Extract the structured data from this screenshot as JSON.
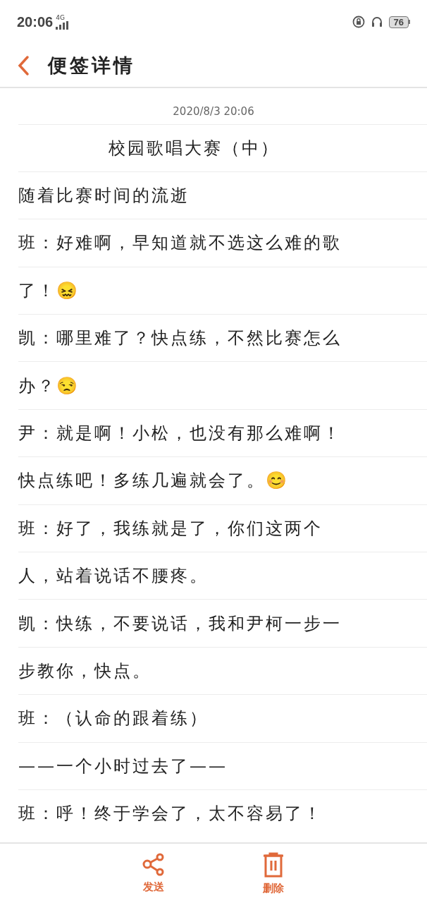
{
  "status_bar": {
    "time": "20:06",
    "network": "4G",
    "battery": "76"
  },
  "header": {
    "title": "便签详情"
  },
  "note": {
    "date": "2020/8/3 20:06",
    "title": "校园歌唱大赛（中）",
    "lines": [
      {
        "text": "随着比赛时间的流逝"
      },
      {
        "text": "班：好难啊，早知道就不选这么难的歌"
      },
      {
        "text": "了！😖"
      },
      {
        "text": "凯：哪里难了？快点练，不然比赛怎么"
      },
      {
        "text": "办？😒"
      },
      {
        "text": "尹：就是啊！小松，也没有那么难啊！"
      },
      {
        "text": "快点练吧！多练几遍就会了。😊"
      },
      {
        "text": "班：好了，我练就是了，你们这两个"
      },
      {
        "text": "人，站着说话不腰疼。"
      },
      {
        "text": "凯：快练，不要说话，我和尹柯一步一"
      },
      {
        "text": "步教你，快点。"
      },
      {
        "text": "班：（认命的跟着练）"
      },
      {
        "text": "——一个小时过去了——"
      },
      {
        "text": "班：呼！终于学会了，太不容易了！"
      }
    ]
  },
  "toolbar": [
    {
      "kind": "share",
      "label": "发送"
    },
    {
      "kind": "delete",
      "label": "删除"
    }
  ]
}
